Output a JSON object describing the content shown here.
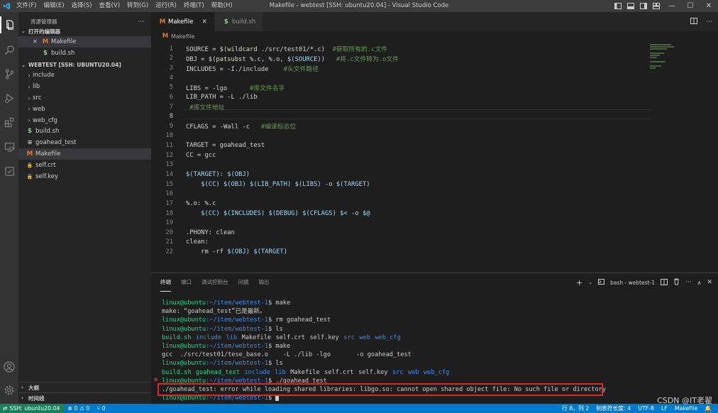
{
  "window": {
    "title": "Makefile - webtest [SSH: ubuntu20.04] - Visual Studio Code",
    "menu": [
      "文件(F)",
      "编辑(E)",
      "选择(S)",
      "查看(V)",
      "转到(G)",
      "运行(R)",
      "终端(T)",
      "帮助(H)"
    ]
  },
  "sidebar": {
    "header": "资源管理器",
    "more": "···",
    "open_editors_title": "打开的编辑器",
    "open_editors": [
      {
        "name": "Makefile",
        "icon": "M",
        "close": "✕"
      },
      {
        "name": "build.sh",
        "icon": "$"
      }
    ],
    "workspace_title": "WEBTEST [SSH: UBUNTU20.04]",
    "items": [
      {
        "name": "include",
        "type": "folder"
      },
      {
        "name": "lib",
        "type": "folder"
      },
      {
        "name": "src",
        "type": "folder"
      },
      {
        "name": "web",
        "type": "folder"
      },
      {
        "name": "web_cfg",
        "type": "folder"
      },
      {
        "name": "build.sh",
        "type": "file",
        "icon": "$"
      },
      {
        "name": "goahead_test",
        "type": "file",
        "icon": "≡"
      },
      {
        "name": "Makefile",
        "type": "file",
        "icon": "M"
      },
      {
        "name": "self.crt",
        "type": "file",
        "icon": "🔒"
      },
      {
        "name": "self.key",
        "type": "file",
        "icon": "🔒"
      }
    ],
    "outline": "大纲",
    "timeline": "时间线"
  },
  "tabs": [
    {
      "label": "Makefile",
      "icon": "M",
      "close": "✕"
    },
    {
      "label": "build.sh",
      "icon": "$"
    }
  ],
  "breadcrumb": "Makefile",
  "code": [
    {
      "n": "1",
      "segs": [
        [
          "SOURCE = ",
          "def"
        ],
        [
          "$(",
          "def"
        ],
        [
          "wildcard",
          "fn"
        ],
        [
          " ./src/test01/*.c)",
          "def"
        ],
        [
          "  #获取所有的.c文件",
          "cm"
        ]
      ]
    },
    {
      "n": "2",
      "segs": [
        [
          "OBJ = ",
          "def"
        ],
        [
          "$(",
          "def"
        ],
        [
          "patsubst",
          "fn"
        ],
        [
          " %.c, %.o, ",
          "def"
        ],
        [
          "$(SOURCE)",
          "var"
        ],
        [
          ")",
          "def"
        ],
        [
          "   #将.c文件转为.o文件",
          "cm"
        ]
      ]
    },
    {
      "n": "3",
      "segs": [
        [
          "INCLUDES = -I./include",
          "def"
        ],
        [
          "    #头文件路径",
          "cm"
        ]
      ]
    },
    {
      "n": "4",
      "segs": []
    },
    {
      "n": "5",
      "segs": [
        [
          "LIBS = -lgo",
          "def"
        ],
        [
          "      #库文件名字",
          "cm"
        ]
      ]
    },
    {
      "n": "6",
      "segs": [
        [
          "LIB_PATH = -L ./lib",
          "def"
        ]
      ]
    },
    {
      "n": "7",
      "segs": [
        [
          " #库文件地址",
          "cm"
        ]
      ]
    },
    {
      "n": "8",
      "segs": []
    },
    {
      "n": "9",
      "segs": [
        [
          "CFLAGS = -Wall -c",
          "def"
        ],
        [
          "   #编译标志位",
          "cm"
        ]
      ]
    },
    {
      "n": "10",
      "segs": []
    },
    {
      "n": "11",
      "segs": [
        [
          "TARGET = goahead_test",
          "def"
        ]
      ]
    },
    {
      "n": "12",
      "segs": [
        [
          "CC = gcc",
          "def"
        ]
      ]
    },
    {
      "n": "13",
      "segs": []
    },
    {
      "n": "14",
      "segs": [
        [
          "$(TARGET)",
          "var"
        ],
        [
          ": ",
          "def"
        ],
        [
          "$(OBJ)",
          "var"
        ]
      ]
    },
    {
      "n": "15",
      "segs": [
        [
          "    ",
          "def"
        ],
        [
          "$(CC)",
          "var"
        ],
        [
          " ",
          "def"
        ],
        [
          "$(OBJ)",
          "var"
        ],
        [
          " ",
          "def"
        ],
        [
          "$(LIB_PATH)",
          "var"
        ],
        [
          " ",
          "def"
        ],
        [
          "$(LIBS)",
          "var"
        ],
        [
          " -o ",
          "def"
        ],
        [
          "$(TARGET)",
          "var"
        ]
      ]
    },
    {
      "n": "16",
      "segs": []
    },
    {
      "n": "17",
      "segs": [
        [
          "%.o: %.c",
          "def"
        ]
      ]
    },
    {
      "n": "18",
      "segs": [
        [
          "    ",
          "def"
        ],
        [
          "$(CC)",
          "var"
        ],
        [
          " ",
          "def"
        ],
        [
          "$(INCLUDES)",
          "var"
        ],
        [
          " ",
          "def"
        ],
        [
          "$(DEBUG)",
          "var"
        ],
        [
          " ",
          "def"
        ],
        [
          "$(CFLAGS)",
          "var"
        ],
        [
          " ",
          "def"
        ],
        [
          "$<",
          "var"
        ],
        [
          " -o ",
          "def"
        ],
        [
          "$@",
          "var"
        ]
      ]
    },
    {
      "n": "19",
      "segs": []
    },
    {
      "n": "20",
      "segs": [
        [
          ".PHONY: clean",
          "def"
        ]
      ]
    },
    {
      "n": "21",
      "segs": [
        [
          "clean:",
          "def"
        ]
      ]
    },
    {
      "n": "22",
      "segs": [
        [
          "    rm -rf ",
          "def"
        ],
        [
          "$(OBJ)",
          "var"
        ],
        [
          " ",
          "def"
        ],
        [
          "$(TARGET)",
          "var"
        ]
      ]
    }
  ],
  "panel": {
    "tabs": [
      "终端",
      "端口",
      "调试控制台",
      "问题",
      "输出"
    ],
    "terminal_name": "bash - webtest-1",
    "prompt_user": "linux@ubuntu",
    "prompt_path": ":~/item/webtest-1",
    "prompt_sym": "$",
    "lines": [
      {
        "type": "prompt",
        "cmd": " make"
      },
      {
        "type": "out",
        "text": "make: “goahead_test”已是最新。"
      },
      {
        "type": "prompt",
        "cmd": " rm goahead_test"
      },
      {
        "type": "prompt",
        "cmd": " ls"
      },
      {
        "type": "ls",
        "items": [
          [
            "build.sh",
            "g"
          ],
          [
            "include",
            "b"
          ],
          [
            "lib",
            "b"
          ],
          [
            "Makefile",
            "w"
          ],
          [
            "self.crt",
            "w"
          ],
          [
            "self.key",
            "w"
          ],
          [
            "src",
            "b"
          ],
          [
            "web",
            "b"
          ],
          [
            "web_cfg",
            "b"
          ]
        ]
      },
      {
        "type": "prompt",
        "cmd": " make"
      },
      {
        "type": "out",
        "text": "gcc  ./src/test01/tese_base.o    -L ./lib -lgo       -o goahead_test"
      },
      {
        "type": "prompt",
        "cmd": " ls"
      },
      {
        "type": "ls",
        "items": [
          [
            "build.sh",
            "g"
          ],
          [
            "goahead_test",
            "g"
          ],
          [
            "include",
            "b"
          ],
          [
            "lib",
            "b"
          ],
          [
            "Makefile",
            "w"
          ],
          [
            "self.crt",
            "w"
          ],
          [
            "self.key",
            "w"
          ],
          [
            "src",
            "b"
          ],
          [
            "web",
            "b"
          ],
          [
            "web_cfg",
            "b"
          ]
        ]
      },
      {
        "type": "prompt",
        "cmd": " ./goahead_test"
      },
      {
        "type": "out",
        "text": "./goahead_test: error while loading shared libraries: libgo.so: cannot open shared object file: No such file or directory"
      },
      {
        "type": "prompt",
        "cmd": " "
      }
    ]
  },
  "status": {
    "remote": "SSH: ubuntu20.04",
    "errors": "⊗ 0 ⚠ 0",
    "ports": "⑂ 0",
    "position": "行 8，列 2",
    "indent": "制表符长度: 4",
    "encoding": "UTF-8",
    "eol": "LF",
    "language": "Makefile"
  },
  "watermark": "CSDN @IT老翟",
  "colors": {
    "accent": "#007acc",
    "remote": "#16825d",
    "error_box": "#e02828"
  }
}
